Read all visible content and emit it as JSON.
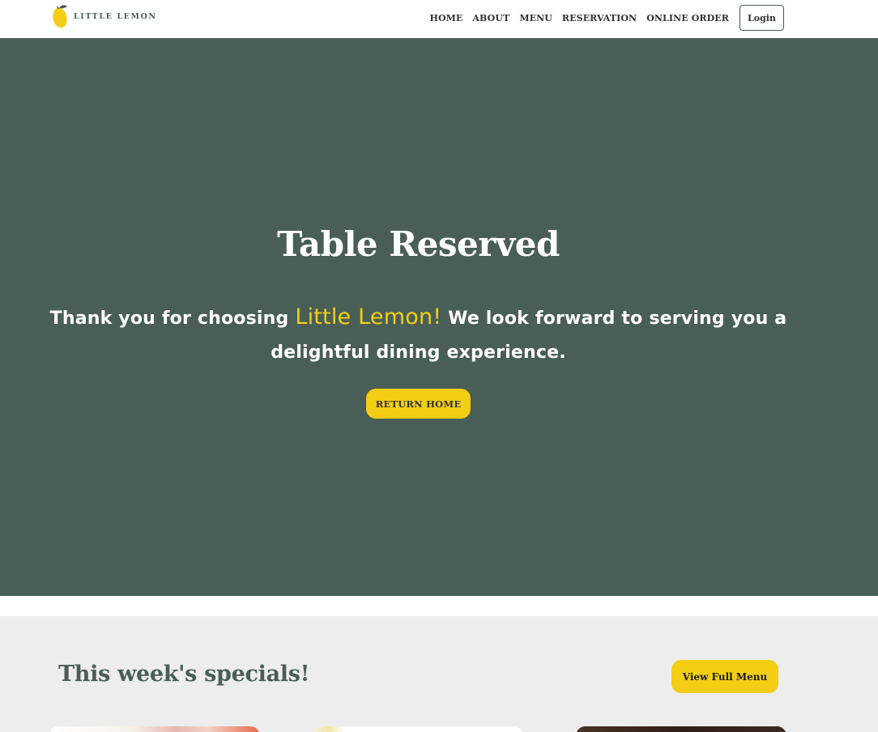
{
  "header": {
    "logo_text": "LITTLE LEMON",
    "nav": [
      "HOME",
      "ABOUT",
      "MENU",
      "RESERVATION",
      "ONLINE ORDER"
    ],
    "login_label": "Login"
  },
  "hero": {
    "title": "Table Reserved",
    "message_before": "Thank you for choosing ",
    "brand": "Little Lemon!",
    "message_after": " We look forward to serving you a delightful dining experience.",
    "button_label": "RETURN HOME"
  },
  "specials": {
    "title": "This week's specials!",
    "button_label": "View Full Menu"
  },
  "colors": {
    "primary_green": "#495e57",
    "accent_yellow": "#f4ce14",
    "section_gray": "#ededed"
  }
}
